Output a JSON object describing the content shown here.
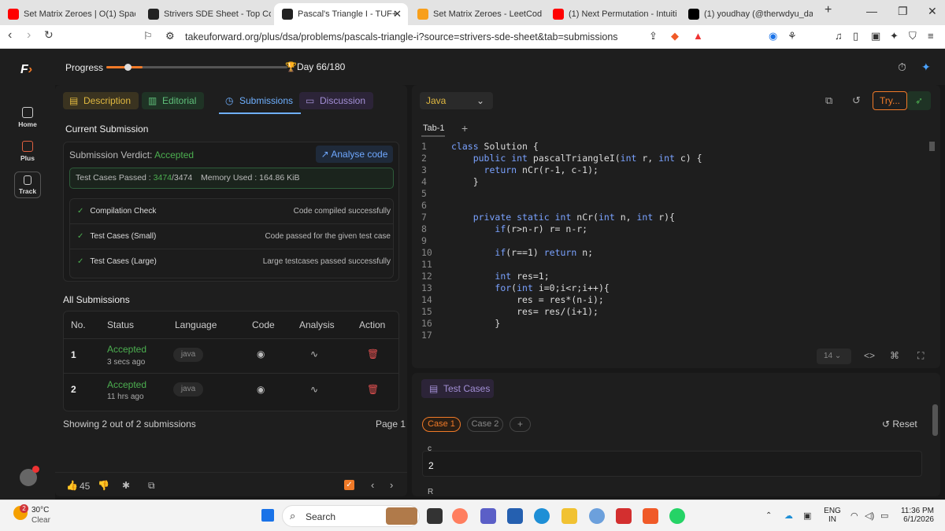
{
  "browser": {
    "tabs": [
      {
        "label": "Set Matrix Zeroes | O(1) Space A",
        "icon": "youtube-icon",
        "color": "#ff0000"
      },
      {
        "label": "Strivers SDE Sheet - Top Coding",
        "icon": "tuf-icon",
        "color": "#222222"
      },
      {
        "label": "Pascal's Triangle I - TUF+",
        "icon": "tuf-icon",
        "color": "#222222"
      },
      {
        "label": "Set Matrix Zeroes - LeetCode",
        "icon": "leetcode-icon",
        "color": "#f89f1b"
      },
      {
        "label": "(1) Next Permutation - Intuition",
        "icon": "youtube-icon",
        "color": "#ff0000"
      },
      {
        "label": "(1) youdhay (@therwdyu_day16",
        "icon": "x-icon",
        "color": "#000000"
      }
    ],
    "url": "takeuforward.org/plus/dsa/problems/pascals-triangle-i?source=strivers-sde-sheet&tab=submissions"
  },
  "sidebar": {
    "items": [
      {
        "label": "Home"
      },
      {
        "label": "Plus"
      },
      {
        "label": "Track"
      }
    ]
  },
  "topbar": {
    "progress_label": "Progress",
    "day_label": "Day 66/180",
    "progress_fraction": 0.2
  },
  "problem_tabs": {
    "description": "Description",
    "editorial": "Editorial",
    "submissions": "Submissions",
    "discussion": "Discussion"
  },
  "current_submission": {
    "heading": "Current Submission",
    "verdict_label": "Submission Verdict:",
    "verdict_value": "Accepted",
    "analyse_button": "Analyse code",
    "tests_label": "Test Cases Passed :",
    "tests_passed": "3474",
    "tests_total": "/3474",
    "memory_label": "Memory Used : 164.86 KiB",
    "checks": [
      {
        "name": "Compilation Check",
        "result": "Code compiled successfully"
      },
      {
        "name": "Test Cases (Small)",
        "result": "Code passed for the given test case"
      },
      {
        "name": "Test Cases (Large)",
        "result": "Large testcases passed successfully"
      }
    ]
  },
  "all_submissions": {
    "heading": "All Submissions",
    "columns": [
      "No.",
      "Status",
      "Language",
      "Code",
      "Analysis",
      "Action"
    ],
    "rows": [
      {
        "no": "1",
        "status": "Accepted",
        "time": "3 secs ago",
        "language": "java"
      },
      {
        "no": "2",
        "status": "Accepted",
        "time": "11 hrs ago",
        "language": "java"
      }
    ],
    "showing": "Showing 2 out of 2 submissions",
    "page": "Page 1"
  },
  "footer": {
    "likes": "45"
  },
  "editor": {
    "language": "Java",
    "try_button": "Try...",
    "tab_label": "Tab-1",
    "font_size": "14",
    "lines": [
      "class Solution {",
      "    public int pascalTriangleI(int r, int c) {",
      "      return nCr(r-1, c-1);",
      "    }",
      "",
      "",
      "    private static int nCr(int n, int r){",
      "        if(r>n-r) r= n-r;",
      "",
      "        if(r==1) return n;",
      "",
      "        int res=1;",
      "        for(int i=0;i<r;i++){",
      "            res = res*(n-i);",
      "            res= res/(i+1);",
      "        }",
      ""
    ]
  },
  "testcases": {
    "title": "Test Cases",
    "cases": [
      "Case 1",
      "Case 2"
    ],
    "reset": "Reset",
    "var1_name": "c",
    "var1_value": "2",
    "var2_name": "R"
  },
  "taskbar": {
    "temp": "30°C",
    "weather": "Clear",
    "weather_badge": "2",
    "search": "Search",
    "lang1": "ENG",
    "lang2": "IN",
    "time": "11:36 PM",
    "date": "6/1/2026"
  }
}
